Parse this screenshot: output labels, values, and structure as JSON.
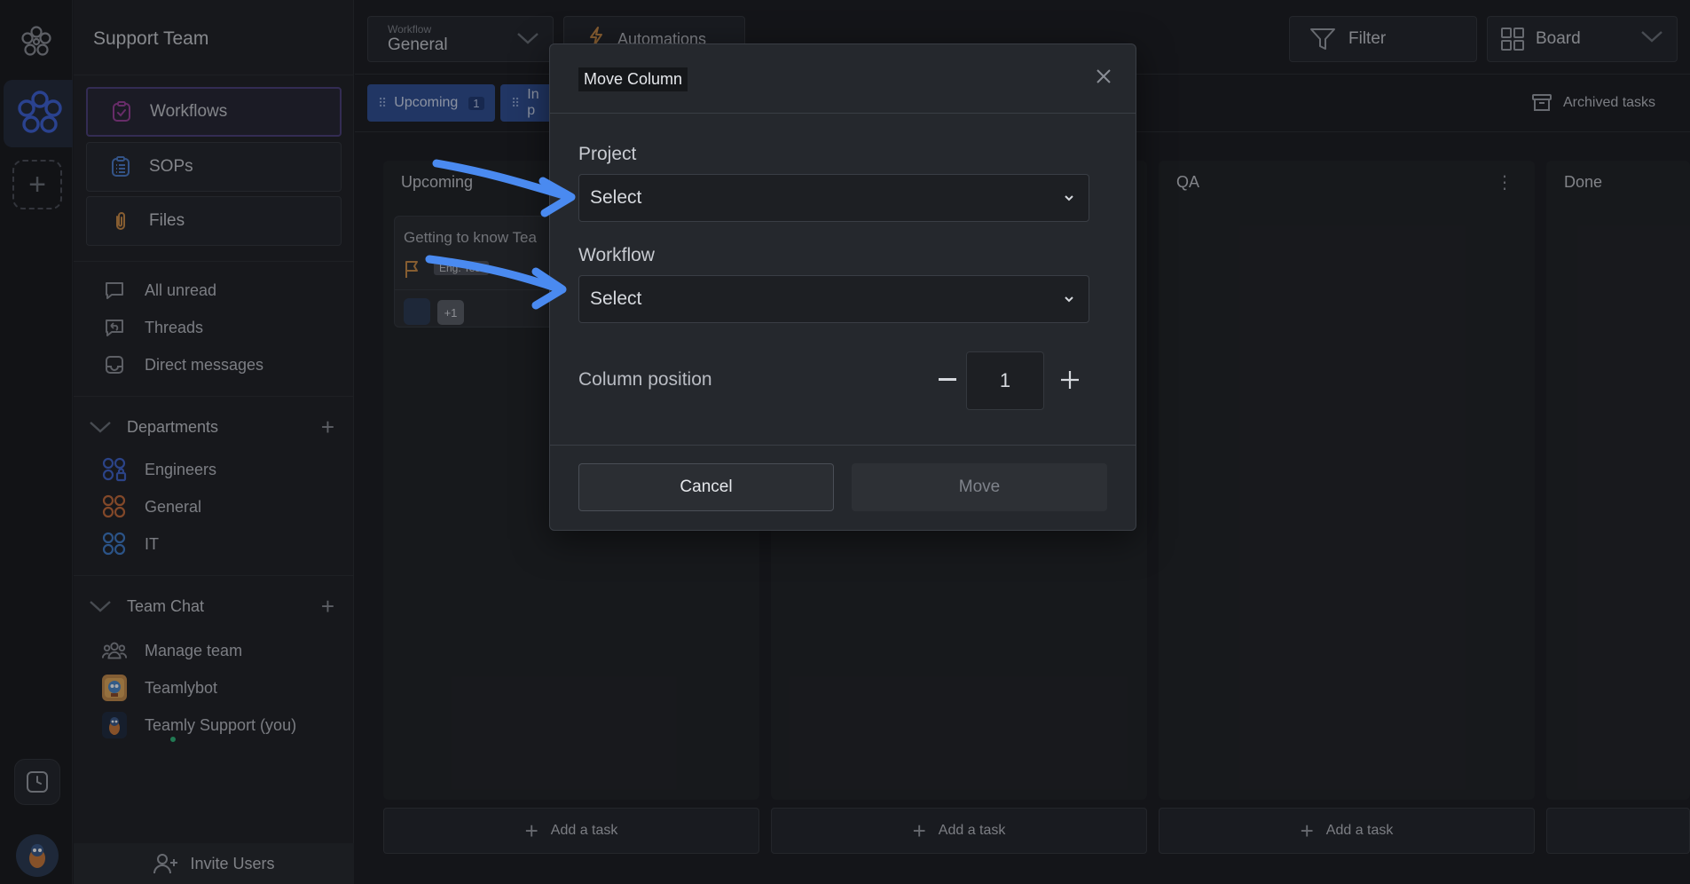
{
  "sidebar": {
    "team_name": "Support Team",
    "nav": [
      {
        "label": "Workflows"
      },
      {
        "label": "SOPs"
      },
      {
        "label": "Files"
      }
    ],
    "inbox": [
      {
        "label": "All unread"
      },
      {
        "label": "Threads"
      },
      {
        "label": "Direct messages"
      }
    ],
    "departments": {
      "title": "Departments",
      "items": [
        {
          "label": "Engineers",
          "color": "#3e63c9"
        },
        {
          "label": "General",
          "color": "#c46a3a"
        },
        {
          "label": "IT",
          "color": "#3e7cc9"
        }
      ]
    },
    "team_chat": {
      "title": "Team Chat",
      "items": [
        {
          "label": "Manage team"
        },
        {
          "label": "Teamlybot"
        },
        {
          "label": "Teamly Support (you)"
        }
      ]
    },
    "invite_label": "Invite Users"
  },
  "topbar": {
    "workflow_label": "Workflow",
    "workflow_value": "General",
    "automations_label": "Automations",
    "filter_label": "Filter",
    "board_label": "Board"
  },
  "subbar": {
    "chips": [
      {
        "label": "Upcoming",
        "count": "1"
      },
      {
        "label": "In p"
      }
    ],
    "archived_label": "Archived tasks"
  },
  "columns": [
    {
      "title": "Upcoming"
    },
    {
      "title": ""
    },
    {
      "title": "QA"
    },
    {
      "title": "Done"
    }
  ],
  "task": {
    "title": "Getting to know Tea",
    "tag": "Eng. Test",
    "more_count": "+1"
  },
  "add_task_label": "Add a task",
  "modal": {
    "title": "Move Column",
    "project_label": "Project",
    "project_value": "Select",
    "workflow_label": "Workflow",
    "workflow_value": "Select",
    "position_label": "Column position",
    "position_value": "1",
    "cancel_label": "Cancel",
    "move_label": "Move"
  },
  "colors": {
    "accent": "#2e4f94",
    "arrow": "#4a8af0",
    "workflows_icon": "#9a3f9a"
  }
}
